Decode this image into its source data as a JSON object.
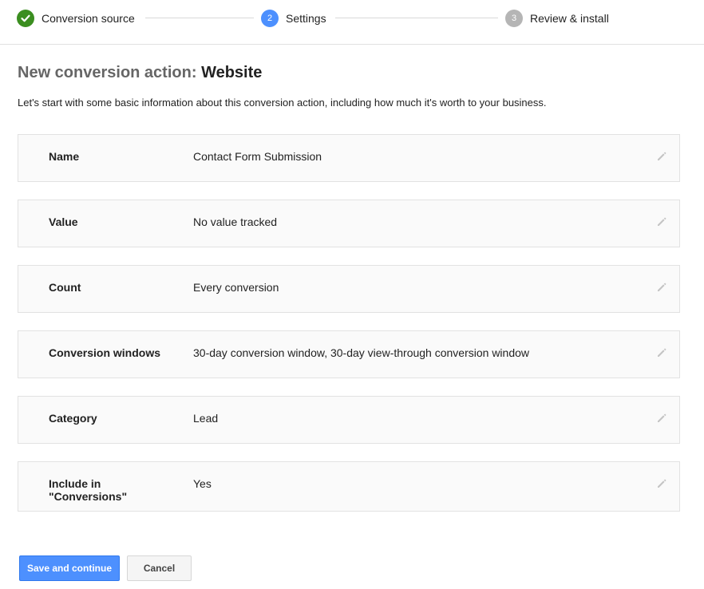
{
  "stepper": {
    "steps": [
      {
        "label": "Conversion source",
        "icon": "check-icon",
        "status": "complete",
        "color": "#3b8e20"
      },
      {
        "label": "Settings",
        "number": "2",
        "status": "current",
        "color": "#4d90fe"
      },
      {
        "label": "Review & install",
        "number": "3",
        "status": "upcoming",
        "color": "#b5b5b5"
      }
    ]
  },
  "header": {
    "title_prefix": "New conversion action:",
    "title_type": "Website",
    "intro": "Let's start with some basic information about this conversion action, including how much it's worth to your business."
  },
  "settings": [
    {
      "label": "Name",
      "value": "Contact Form Submission"
    },
    {
      "label": "Value",
      "value": "No value tracked"
    },
    {
      "label": "Count",
      "value": "Every conversion"
    },
    {
      "label": "Conversion windows",
      "value": "30-day conversion window, 30-day view-through conversion window"
    },
    {
      "label": "Category",
      "value": "Lead"
    },
    {
      "label": "Include in \"Conversions\"",
      "value": "Yes"
    }
  ],
  "actions": {
    "save_label": "Save and continue",
    "cancel_label": "Cancel"
  },
  "colors": {
    "accent": "#4d90fe",
    "complete": "#3b8e20"
  }
}
